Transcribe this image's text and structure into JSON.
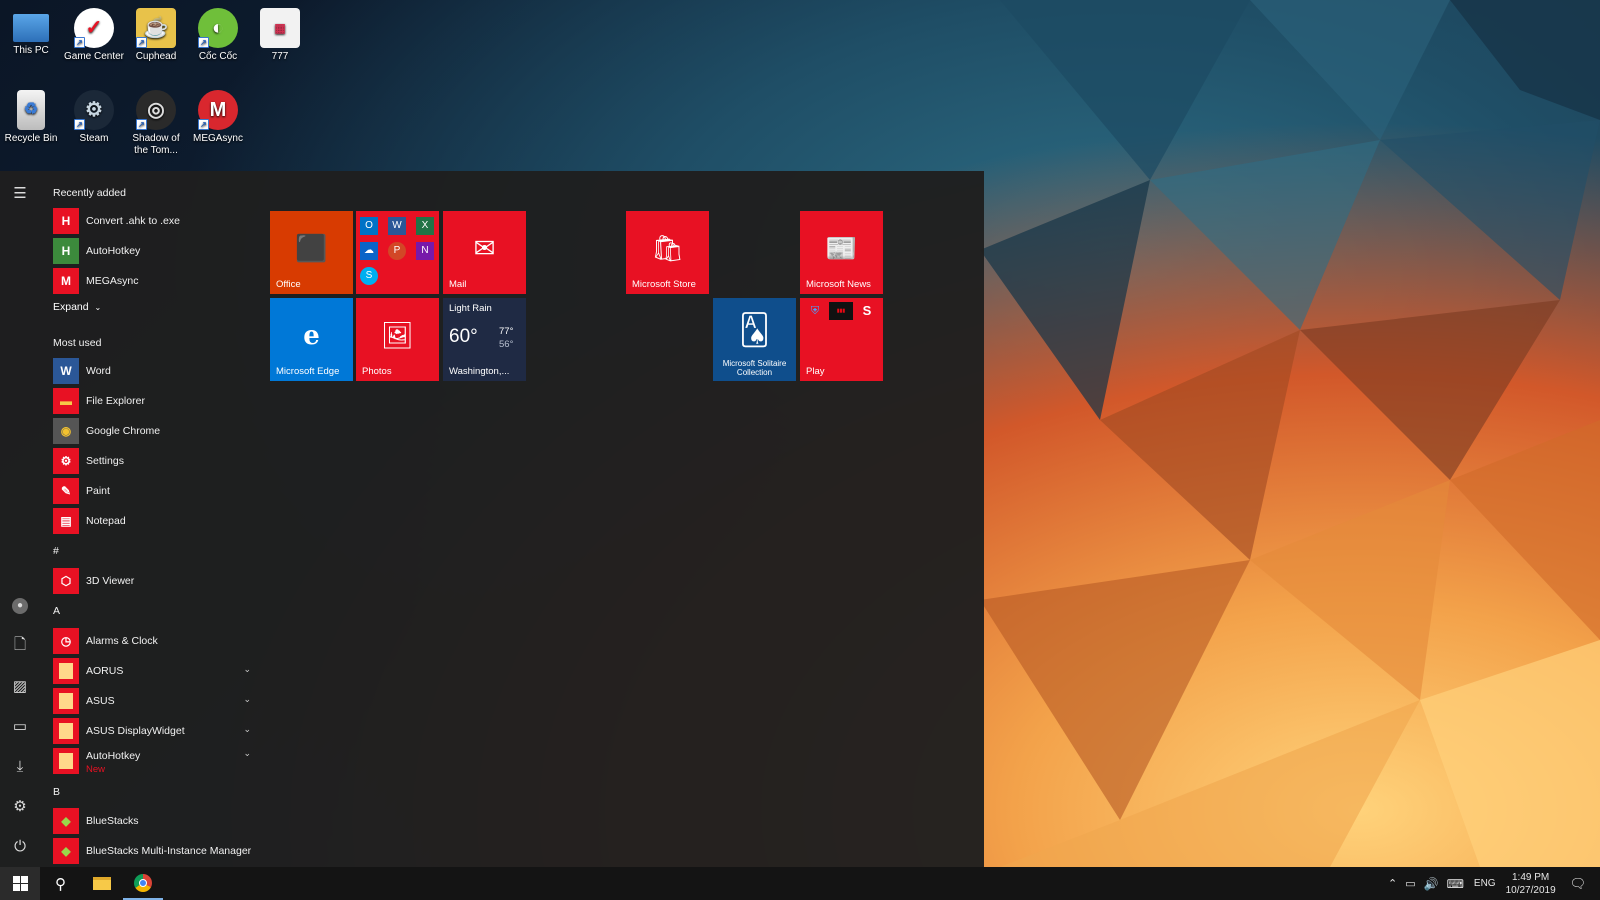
{
  "desktop": {
    "icons": [
      {
        "label": "This PC"
      },
      {
        "label": "Game Center"
      },
      {
        "label": "Cuphead"
      },
      {
        "label": "Cốc Cốc"
      },
      {
        "label": "777"
      },
      {
        "label": "Recycle Bin"
      },
      {
        "label": "Steam"
      },
      {
        "label": "Shadow of the Tom..."
      },
      {
        "label": "MEGAsync"
      }
    ]
  },
  "start_menu": {
    "recently_added": {
      "heading": "Recently added",
      "items": [
        {
          "label": "Convert .ahk to .exe",
          "icon": "H",
          "color": "#e81123"
        },
        {
          "label": "AutoHotkey",
          "icon": "H",
          "color": "#3c8a3c"
        },
        {
          "label": "MEGAsync",
          "icon": "M",
          "color": "#e81123"
        }
      ],
      "expand_label": "Expand"
    },
    "most_used": {
      "heading": "Most used",
      "items": [
        {
          "label": "Word",
          "icon": "W",
          "color": "#2b5797"
        },
        {
          "label": "File Explorer",
          "icon": "▬",
          "color": "#e81123"
        },
        {
          "label": "Google Chrome",
          "icon": "◉",
          "color": "#555555"
        },
        {
          "label": "Settings",
          "icon": "⚙",
          "color": "#e81123"
        },
        {
          "label": "Paint",
          "icon": "✎",
          "color": "#e81123"
        },
        {
          "label": "Notepad",
          "icon": "▤",
          "color": "#e81123"
        }
      ]
    },
    "letters": {
      "hash": "#",
      "a": "A",
      "b": "B"
    },
    "alpha_items": [
      {
        "label": "3D Viewer",
        "icon": "⬡",
        "color": "#e81123"
      },
      {
        "label": "Alarms & Clock",
        "icon": "◷",
        "color": "#e81123"
      },
      {
        "label": "AORUS",
        "icon": "",
        "color": "#e81123"
      },
      {
        "label": "ASUS",
        "icon": "",
        "color": "#e81123"
      },
      {
        "label": "ASUS DisplayWidget",
        "icon": "",
        "color": "#e81123"
      },
      {
        "label": "AutoHotkey",
        "icon": "",
        "color": "#e81123",
        "sub": "New"
      },
      {
        "label": "BlueStacks",
        "icon": "◆",
        "color": "#e81123"
      },
      {
        "label": "BlueStacks Multi-Instance Manager",
        "icon": "◆",
        "color": "#e81123"
      }
    ],
    "tiles": {
      "office": "Office",
      "mail": "Mail",
      "store": "Microsoft Store",
      "news": "Microsoft News",
      "edge": "Microsoft Edge",
      "photos": "Photos",
      "weather": {
        "condition": "Light Rain",
        "temp": "60°",
        "high": "77°",
        "low": "56°",
        "location": "Washington,..."
      },
      "solitaire": "Microsoft Solitaire Collection",
      "play": "Play"
    }
  },
  "taskbar": {
    "language": "ENG",
    "time": "1:49 PM",
    "date": "10/27/2019"
  }
}
